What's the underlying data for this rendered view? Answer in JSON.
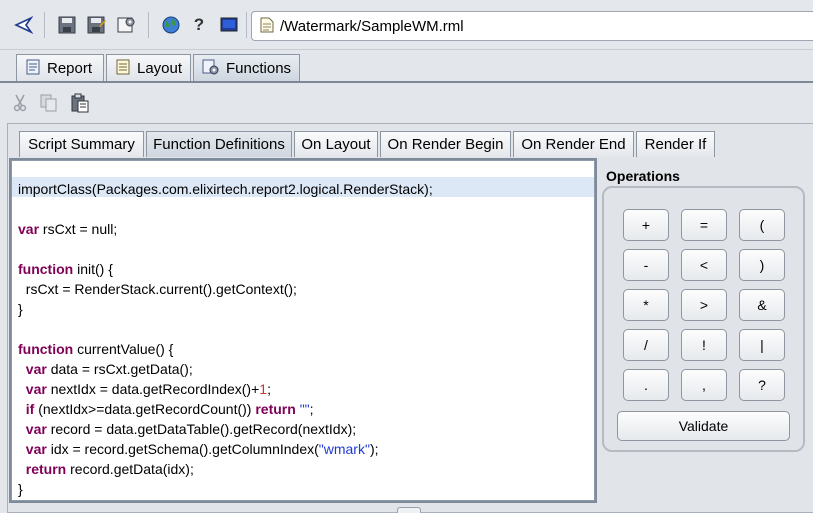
{
  "toolbar": {
    "icons": [
      "back-arrow-icon",
      "save-icon",
      "save-as-icon",
      "properties-icon",
      "globe-icon",
      "help-icon",
      "monitor-icon"
    ],
    "path": "/Watermark/SampleWM.rml",
    "path_icon": "document-icon"
  },
  "top_tabs": [
    {
      "label": "Report",
      "icon": "report-icon"
    },
    {
      "label": "Layout",
      "icon": "layout-icon"
    },
    {
      "label": "Functions",
      "icon": "functions-icon",
      "active": true
    }
  ],
  "edit_tools": [
    "cut-icon",
    "copy-icon",
    "paste-icon"
  ],
  "script_tabs": [
    {
      "label": "Script Summary"
    },
    {
      "label": "Function Definitions",
      "active": true
    },
    {
      "label": "On Layout"
    },
    {
      "label": "On Render Begin"
    },
    {
      "label": "On Render End"
    },
    {
      "label": "Render If"
    }
  ],
  "code_lines": [
    [
      {
        "t": "importClass(Packages.com.elixirtech.report2.logical.RenderStack);"
      }
    ],
    [],
    [
      {
        "t": "var",
        "k": "kw"
      },
      {
        "t": " rsCxt = null;"
      }
    ],
    [],
    [
      {
        "t": "function",
        "k": "kw"
      },
      {
        "t": " init() {"
      }
    ],
    [
      {
        "t": "  rsCxt = RenderStack.current().getContext();"
      }
    ],
    [
      {
        "t": "}"
      }
    ],
    [],
    [
      {
        "t": "function",
        "k": "kw"
      },
      {
        "t": " currentValue() {"
      }
    ],
    [
      {
        "t": "  "
      },
      {
        "t": "var",
        "k": "kw"
      },
      {
        "t": " data = rsCxt.getData();"
      }
    ],
    [
      {
        "t": "  "
      },
      {
        "t": "var",
        "k": "kw"
      },
      {
        "t": " nextIdx = data.getRecordIndex()+"
      },
      {
        "t": "1",
        "k": "num"
      },
      {
        "t": ";"
      }
    ],
    [
      {
        "t": "  "
      },
      {
        "t": "if",
        "k": "kw"
      },
      {
        "t": " (nextIdx>=data.getRecordCount()) "
      },
      {
        "t": "return",
        "k": "kw"
      },
      {
        "t": " "
      },
      {
        "t": "\"\"",
        "k": "str"
      },
      {
        "t": ";"
      }
    ],
    [
      {
        "t": "  "
      },
      {
        "t": "var",
        "k": "kw"
      },
      {
        "t": " record = data.getDataTable().getRecord(nextIdx);"
      }
    ],
    [
      {
        "t": "  "
      },
      {
        "t": "var",
        "k": "kw"
      },
      {
        "t": " idx = record.getSchema().getColumnIndex("
      },
      {
        "t": "\"wmark\"",
        "k": "str"
      },
      {
        "t": ");"
      }
    ],
    [
      {
        "t": "  "
      },
      {
        "t": "return",
        "k": "kw"
      },
      {
        "t": " record.getData(idx);"
      }
    ],
    [
      {
        "t": "}"
      }
    ]
  ],
  "operations": {
    "title": "Operations",
    "rows": [
      [
        "+",
        "=",
        "("
      ],
      [
        "-",
        "<",
        ")"
      ],
      [
        "*",
        ">",
        "&"
      ],
      [
        "/",
        "!",
        "|"
      ],
      [
        ".",
        ",",
        "?"
      ]
    ],
    "validate_label": "Validate"
  }
}
